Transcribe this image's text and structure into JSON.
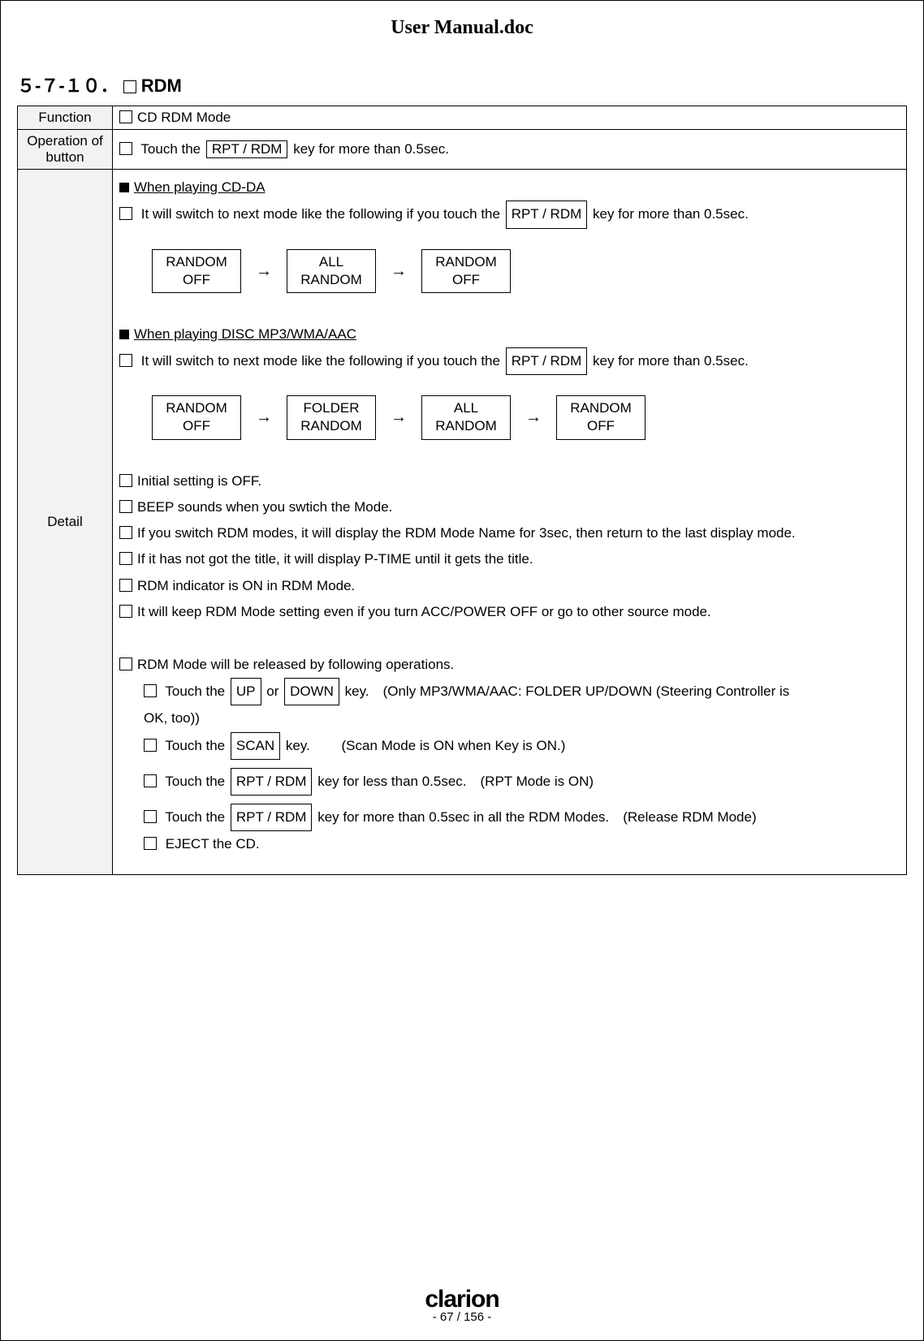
{
  "title": "User Manual.doc",
  "section": "５-７-１０．",
  "section_title": "RDM",
  "labels": {
    "function": "Function",
    "operation": "Operation of button",
    "detail": "Detail"
  },
  "function_row": "CD RDM Mode",
  "operation_prefix": "Touch the",
  "key_rpt_rdm": "RPT / RDM",
  "key_up": "UP",
  "key_down": "DOWN",
  "key_scan": "SCAN",
  "operation_suffix": "key for more than 0.5sec.",
  "sub1_title": "When playing CD-DA",
  "switch_line_prefix": "It will switch to next mode like the following if you touch the",
  "switch_line_suffix": "key for more than 0.5sec.",
  "flow_a": [
    "RANDOM",
    "OFF"
  ],
  "flow_b": [
    "ALL",
    "RANDOM"
  ],
  "flow_c": [
    "RANDOM",
    "OFF"
  ],
  "sub2_title": "When playing DISC MP3/WMA/AAC",
  "flow2_a": [
    "RANDOM",
    "OFF"
  ],
  "flow2_b": [
    "FOLDER",
    "RANDOM"
  ],
  "flow2_c": [
    "ALL",
    "RANDOM"
  ],
  "flow2_d": [
    "RANDOM",
    "OFF"
  ],
  "detail_lines": {
    "d1": "Initial setting is OFF.",
    "d2": "BEEP sounds when you swtich the Mode.",
    "d3": "If you switch RDM modes, it will display the RDM Mode Name for 3sec, then return to the last display mode.",
    "d4": "If it has not got the title, it will display P-TIME until it gets the title.",
    "d5": "RDM indicator is ON in RDM Mode.",
    "d6": "It will keep RDM Mode setting even if you turn ACC/POWER OFF or go to other source mode.",
    "d7": "RDM Mode will be released by following operations."
  },
  "rel": {
    "r1_pre": "Touch the",
    "r1_mid": "or",
    "r1_post": "key.　(Only MP3/WMA/AAC: FOLDER UP/DOWN (Steering Controller is",
    "r1_wrap": "OK, too))",
    "r2_pre": "Touch the",
    "r2_post": "key. 　　(Scan Mode is ON when Key is ON.)",
    "r3_pre": "Touch the",
    "r3_post": "key for less than 0.5sec.　(RPT Mode is ON)",
    "r4_pre": "Touch the",
    "r4_post": "key for more than 0.5sec in all the RDM Modes.　(Release RDM Mode)",
    "r5": "EJECT the CD."
  },
  "footer": {
    "brand": "clarion",
    "page": "- 67 / 156 -"
  }
}
